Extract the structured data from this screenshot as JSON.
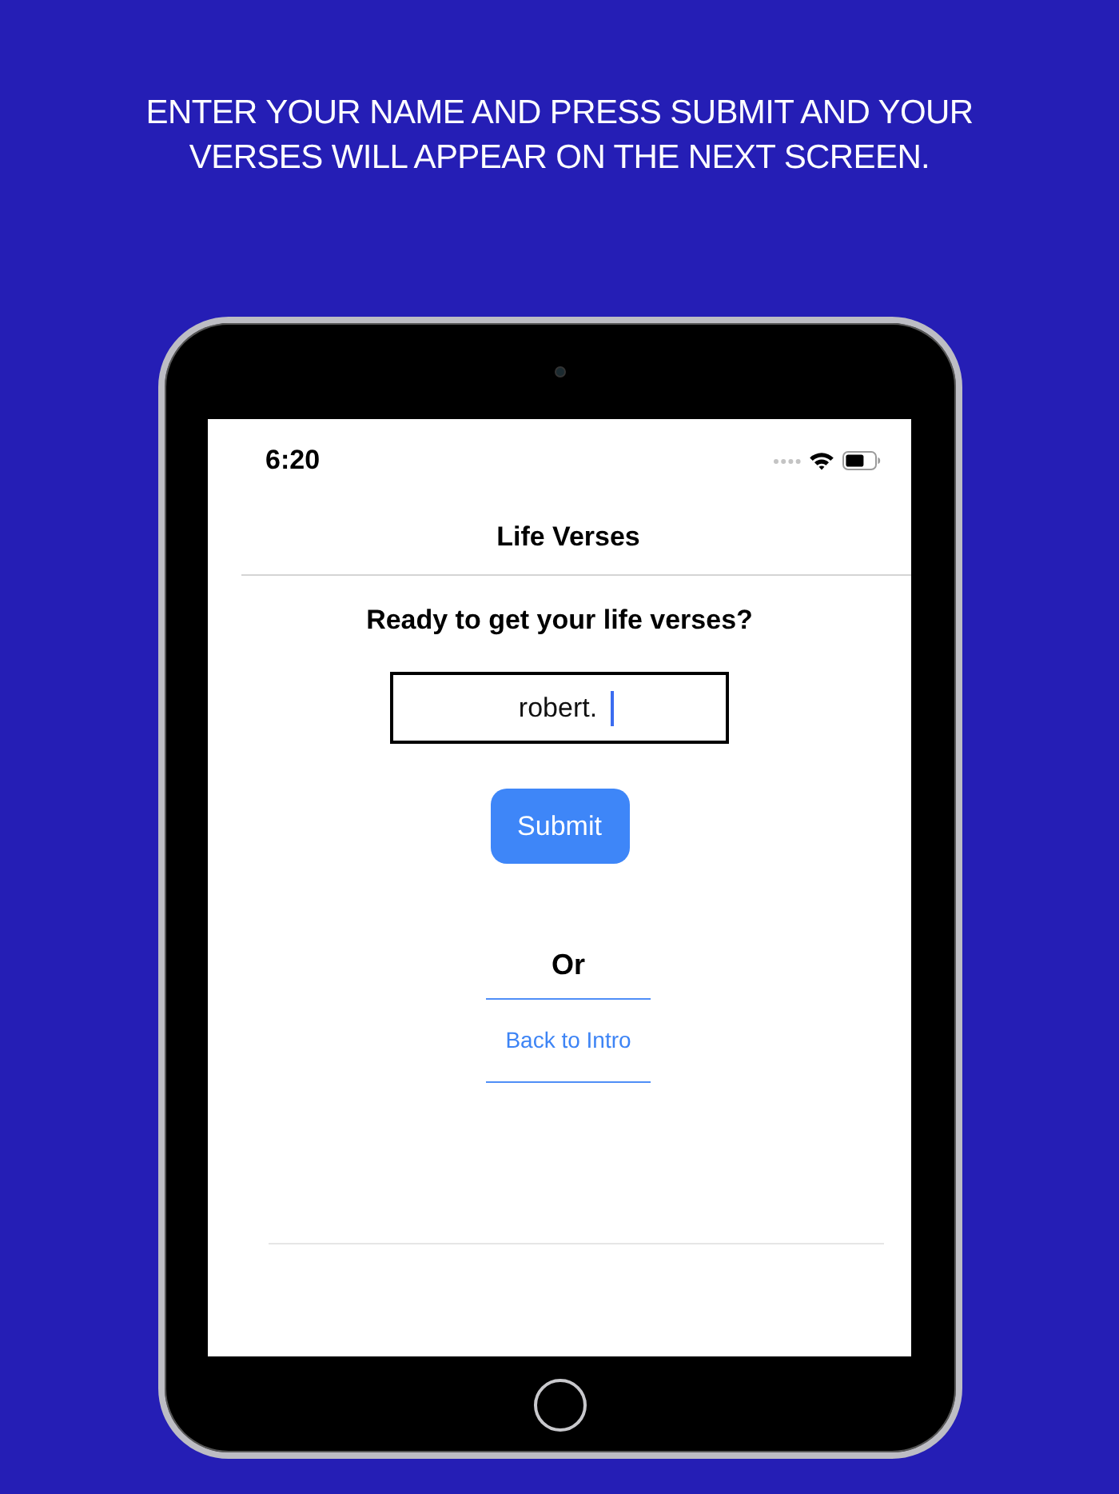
{
  "instruction": "ENTER YOUR NAME AND PRESS SUBMIT AND YOUR VERSES WILL APPEAR ON THE NEXT SCREEN.",
  "status_bar": {
    "time": "6:20"
  },
  "nav_bar": {
    "title": "Life Verses"
  },
  "prompt": "Ready to get your life verses?",
  "name_field": {
    "value": "robert.",
    "focused": true
  },
  "submit_button": {
    "label": "Submit"
  },
  "separator": "Or",
  "back_link": {
    "label": "Back to Intro"
  }
}
